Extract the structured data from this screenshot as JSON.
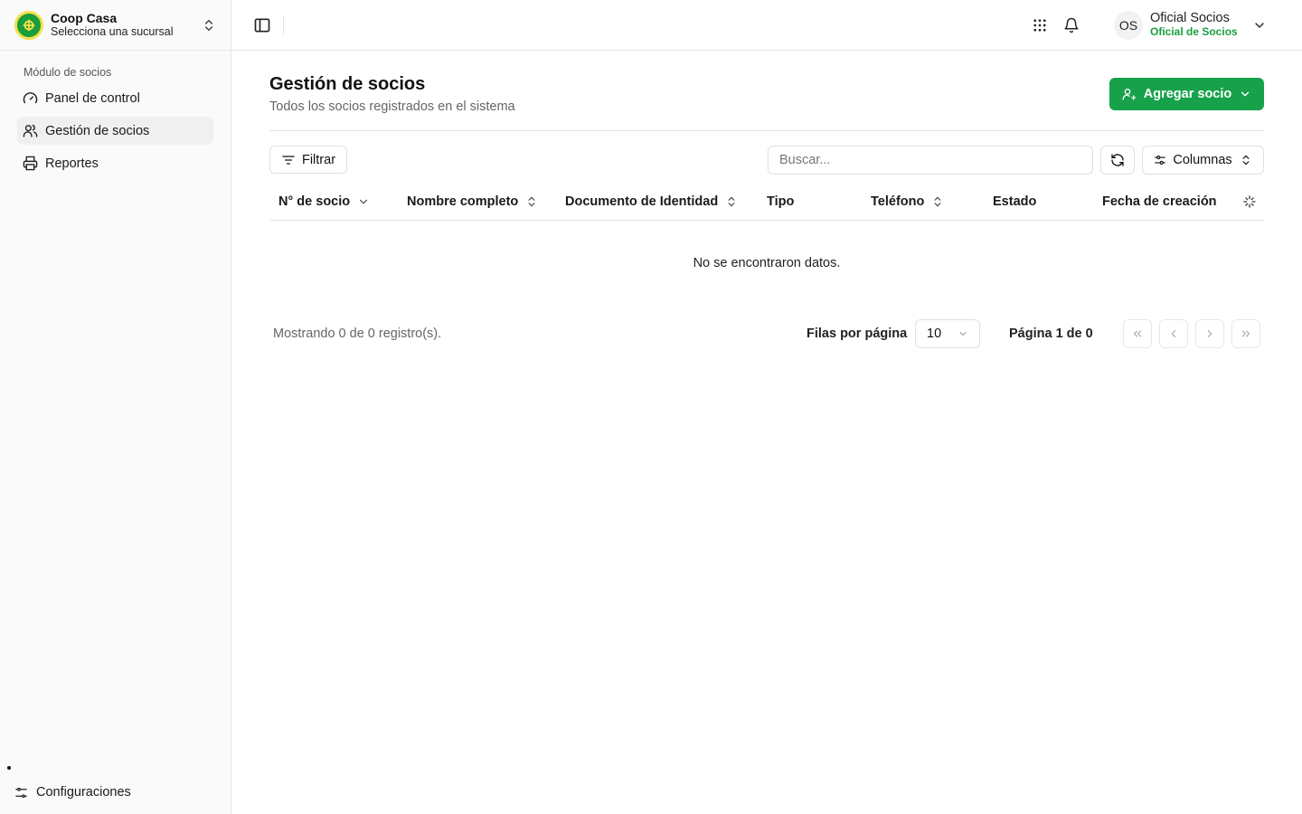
{
  "brand": {
    "title": "Coop Casa",
    "subtitle": "Selecciona una sucursal",
    "logo_color": "#1a9e3c"
  },
  "sidebar": {
    "section_label": "Módulo de socios",
    "items": [
      {
        "label": "Panel de control",
        "icon": "gauge-icon",
        "active": false
      },
      {
        "label": "Gestión de socios",
        "icon": "users-icon",
        "active": true
      },
      {
        "label": "Reportes",
        "icon": "printer-icon",
        "active": false
      }
    ],
    "footer_item": {
      "label": "Configuraciones",
      "icon": "sliders-icon"
    }
  },
  "header": {
    "user": {
      "initials": "OS",
      "name": "Oficial Socios",
      "role": "Oficial de Socios"
    }
  },
  "main": {
    "title": "Gestión de socios",
    "subtitle": "Todos los socios registrados en el sistema",
    "add_button": "Agregar socio",
    "filter_button": "Filtrar",
    "search_placeholder": "Buscar...",
    "columns_button": "Columnas",
    "table": {
      "columns": [
        {
          "label": "N° de socio",
          "sort": "desc"
        },
        {
          "label": "Nombre completo",
          "sort": "both"
        },
        {
          "label": "Documento de Identidad",
          "sort": "both"
        },
        {
          "label": "Tipo",
          "sort": "none"
        },
        {
          "label": "Teléfono",
          "sort": "both"
        },
        {
          "label": "Estado",
          "sort": "none"
        },
        {
          "label": "Fecha de creación",
          "sort": "none"
        }
      ],
      "empty_text": "No se encontraron datos."
    },
    "pagination": {
      "showing": "Mostrando 0 de 0 registro(s).",
      "rows_label": "Filas por página",
      "rows_value": "10",
      "page_info": "Página 1 de 0"
    }
  },
  "colors": {
    "accent": "#17a14a",
    "role_text": "#1a9e3c"
  }
}
